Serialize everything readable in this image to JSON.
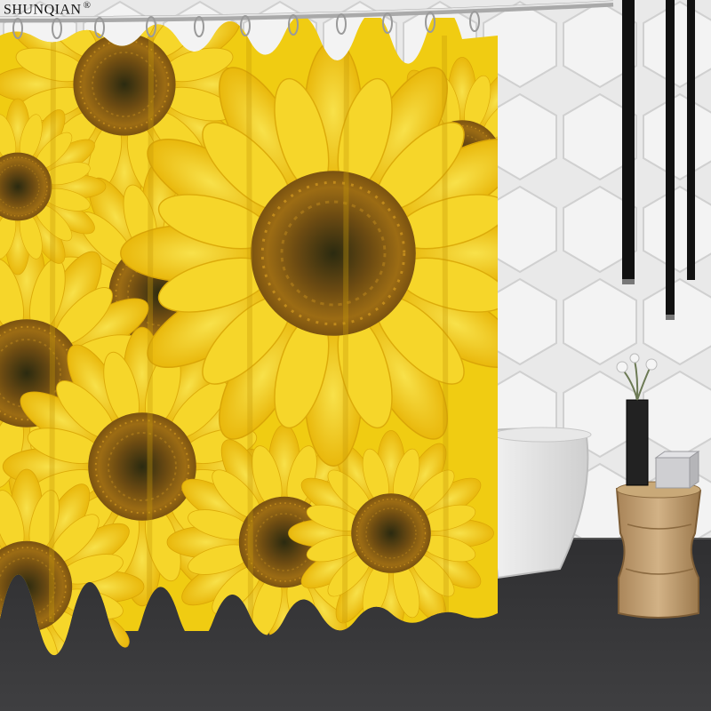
{
  "watermark": {
    "brand": "SHUNQIAN",
    "registered_mark": "®"
  },
  "scene": {
    "curtain_motif": "sunflowers",
    "curtain_color": "#f3d21a",
    "flower_center_color": "#6b4a12",
    "wall_color": "#e4e4e4",
    "floor_color": "#3a3a3c",
    "rod_color": "#b7b7b7"
  }
}
